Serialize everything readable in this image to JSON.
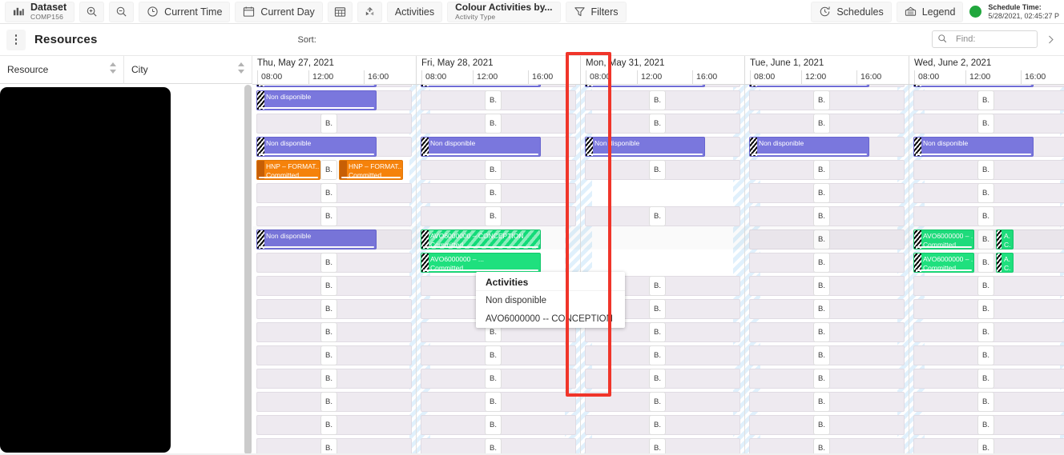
{
  "toolbar": {
    "dataset": {
      "icon": "chart-bars-icon",
      "label": "Dataset",
      "sub": "COMP156"
    },
    "zoom_in": {
      "icon": "zoom-in-icon",
      "label": ""
    },
    "zoom_out": {
      "icon": "zoom-out-icon",
      "label": ""
    },
    "current_time": {
      "icon": "clock-icon",
      "label": "Current Time"
    },
    "current_day": {
      "icon": "calendar-icon",
      "label": "Current Day"
    },
    "calendar_btn": {
      "icon": "calendar-grid-icon",
      "label": ""
    },
    "network_btn": {
      "icon": "network-icon",
      "label": ""
    },
    "activities": {
      "label": "Activities"
    },
    "colour_by": {
      "label": "Colour Activities by...",
      "sub": "Activity Type"
    },
    "filters": {
      "icon": "funnel-icon",
      "label": "Filters"
    },
    "schedules": {
      "icon": "schedule-clock-icon",
      "label": "Schedules"
    },
    "legend": {
      "icon": "legend-icon",
      "label": "Legend"
    },
    "schedule_time": {
      "label": "Schedule Time:",
      "value": "5/28/2021, 02:45:27 P",
      "dot_color": "#21a73d"
    }
  },
  "resource_bar": {
    "menu_icon": "kebab-menu-icon",
    "title": "Resources",
    "sort_label": "Sort:",
    "find": {
      "icon": "search-icon",
      "placeholder": "Find:",
      "value": ""
    },
    "expand_icon": "chevron-right-icon"
  },
  "grid_columns": [
    {
      "label": "Resource",
      "sortable": true
    },
    {
      "label": "City",
      "sortable": true
    }
  ],
  "days": [
    {
      "name": "Thu, May 27, 2021",
      "ticks": [
        "08:00",
        "12:00",
        "16:00"
      ],
      "weekend": false
    },
    {
      "name": "Fri, May 28, 2021",
      "ticks": [
        "08:00",
        "12:00",
        "16:00"
      ],
      "weekend": false
    },
    {
      "name": "Mon, May 31, 2021",
      "ticks": [
        "08:00",
        "12:00",
        "16:00"
      ],
      "weekend": false
    },
    {
      "name": "Tue, June 1, 2021",
      "ticks": [
        "08:00",
        "12:00",
        "16:00"
      ],
      "weekend": false
    },
    {
      "name": "Wed, June 2, 2021",
      "ticks": [
        "08:00",
        "12:00",
        "16:00"
      ],
      "weekend": false
    }
  ],
  "activity_labels": {
    "non_disponible": "Non disponible",
    "hnp_format": "HNP – FORMAT...",
    "committed": "Committed",
    "avo_conception": "AVO6000000 – CONCEPTION",
    "avo_short": "AVO6000000 – ...",
    "b_chip": "B.",
    "a_chip_l1": "A.",
    "a_chip_l2": "C."
  },
  "popup": {
    "title": "Activities",
    "items": [
      "Non disponible",
      "AVO6000000 -- CONCEPTION"
    ]
  },
  "highlight": {
    "color": "#f0352a"
  },
  "colors": {
    "unavailable": "#7a77dd",
    "hnp": "#f5820b",
    "avo": "#1fe07e",
    "cell": "#eeeaf0",
    "weekend_stripe": "#dbeefb"
  }
}
